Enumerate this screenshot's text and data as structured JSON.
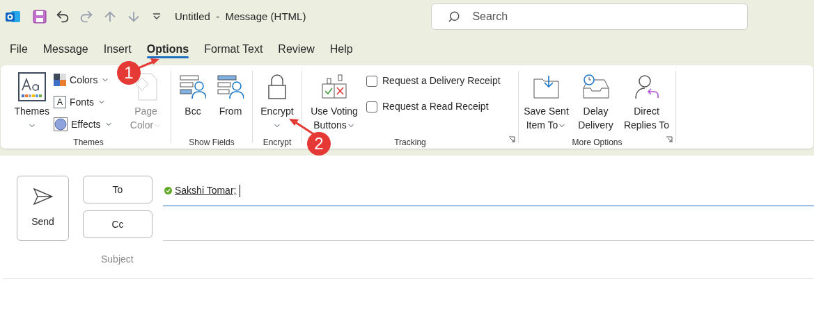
{
  "title_bar": {
    "title": "Untitled  -  Message (HTML)",
    "search": {
      "placeholder": "Search"
    }
  },
  "tabs": [
    {
      "label": "File",
      "selected": false
    },
    {
      "label": "Message",
      "selected": false
    },
    {
      "label": "Insert",
      "selected": false
    },
    {
      "label": "Options",
      "selected": true
    },
    {
      "label": "Format Text",
      "selected": false
    },
    {
      "label": "Review",
      "selected": false
    },
    {
      "label": "Help",
      "selected": false
    }
  ],
  "ribbon": {
    "themes": {
      "label": "Themes",
      "themes_button": "Themes",
      "small": [
        {
          "label": "Colors",
          "kind": "colors"
        },
        {
          "label": "Fonts",
          "kind": "fonts",
          "icon_text": "A"
        },
        {
          "label": "Effects",
          "kind": "effects"
        }
      ],
      "page_color": {
        "label": "Page Color",
        "disabled": true
      }
    },
    "show_fields": {
      "label": "Show Fields",
      "buttons": [
        "Bcc",
        "From"
      ]
    },
    "encrypt": {
      "label": "Encrypt",
      "button": "Encrypt"
    },
    "tracking": {
      "label": "Tracking",
      "voting": "Use Voting Buttons",
      "checks": [
        {
          "label": "Request a Delivery Receipt",
          "checked": false
        },
        {
          "label": "Request a Read Receipt",
          "checked": false
        }
      ]
    },
    "more_options": {
      "label": "More Options",
      "buttons": [
        {
          "label": "Save Sent Item To",
          "kind": "save",
          "dropdown": true
        },
        {
          "label": "Delay Delivery",
          "kind": "delay",
          "dropdown": false
        },
        {
          "label": "Direct Replies To",
          "kind": "replies",
          "dropdown": false
        }
      ]
    }
  },
  "compose": {
    "send": "Send",
    "to": "To",
    "cc": "Cc",
    "subject": "Subject",
    "recipients": [
      "Sakshi Tomar;"
    ]
  },
  "callouts": [
    "1",
    "2"
  ]
}
